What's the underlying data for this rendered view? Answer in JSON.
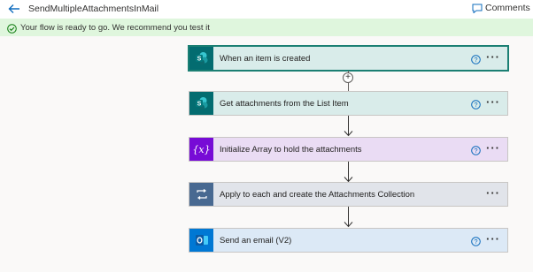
{
  "header": {
    "title": "SendMultipleAttachmentsInMail",
    "comments_label": "Comments (pr"
  },
  "banner": {
    "message": "Your flow is ready to go. We recommend you test it"
  },
  "steps": [
    {
      "label": "When an item is created",
      "icon": "sharepoint-icon",
      "color": "#036c70",
      "selected": true
    },
    {
      "label": "Get attachments from the List Item",
      "icon": "sharepoint-icon",
      "color": "#036c70"
    },
    {
      "label": "Initialize Array to hold the attachments",
      "icon": "variable-icon",
      "icon_text": "{x}",
      "color": "#770bd6"
    },
    {
      "label": "Apply to each and create the Attachments Collection",
      "icon": "loop-icon",
      "color": "#486991"
    },
    {
      "label": "Send an email (V2)",
      "icon": "outlook-icon",
      "icon_text": "O",
      "color": "#0078d4"
    }
  ],
  "menu_glyph": "···",
  "help_glyph": "?",
  "add_glyph": "+"
}
